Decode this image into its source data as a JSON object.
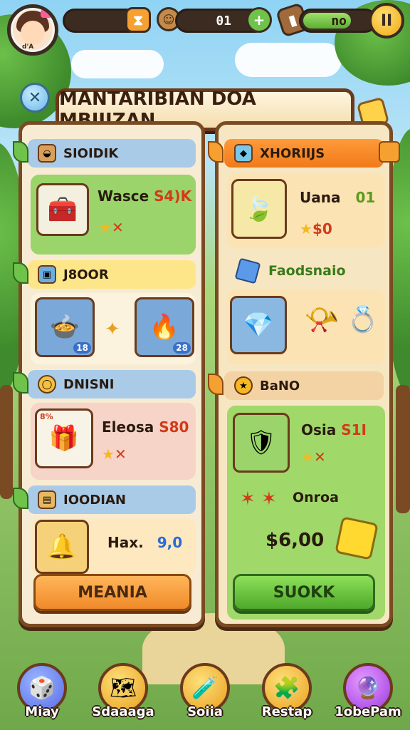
{
  "top_bar": {
    "avatar_tag": "d'A",
    "resource_bar_1": {
      "fill_fraction": 0.0
    },
    "resource_bar_2": {
      "value": "01",
      "fill_fraction": 0.85
    },
    "resource_bar_3": {
      "value": "no",
      "fill_fraction": 0.7
    },
    "plus_label": "+",
    "pause_label": "II"
  },
  "close_label": "✕",
  "title": "MANTARIBIAN DOA MBIIIZAN",
  "left_panel": {
    "sections": [
      {
        "label": "SIOIDIK",
        "icon": "bread-icon"
      },
      {
        "label": "J8OOR",
        "icon": "box-icon"
      },
      {
        "label": "DNISNI",
        "icon": "ring-icon"
      },
      {
        "label": "IOODIAN",
        "icon": "scroll-icon"
      }
    ],
    "item1": {
      "name": "Wasce",
      "price": "S4)K",
      "stars": "★",
      "mark": "✕"
    },
    "item2_a": {
      "badge": "18"
    },
    "item2_b": {
      "badge": "28"
    },
    "item3": {
      "name": "Eleosa",
      "price": "S80",
      "corner": "8%",
      "stars": "★",
      "mark": "✕"
    },
    "item4": {
      "name": "Hax.",
      "value": "9,0"
    },
    "button": "MEANIA"
  },
  "right_panel": {
    "sections": [
      {
        "label": "XHORIIJS",
        "icon": "diamond-icon"
      },
      {
        "label": "Faodsnaio",
        "icon": "cube-icon"
      },
      {
        "label": "BaNO",
        "icon": "star-icon"
      }
    ],
    "item1": {
      "name": "Uana",
      "value": "01",
      "stars": "★",
      "price": "$0"
    },
    "item3": {
      "name": "Osia",
      "price": "S1I",
      "stars": "★",
      "mark": "✕"
    },
    "stars_line": {
      "label": "Onroa"
    },
    "total": "$6,00",
    "button": "SUOKK"
  },
  "bottom_nav": [
    {
      "label": "Miay",
      "icon": "gem-chest-icon"
    },
    {
      "label": "Sdaaaga",
      "icon": "map-icon"
    },
    {
      "label": "Soiia",
      "icon": "potion-icon"
    },
    {
      "label": "Restap",
      "icon": "puzzle-icon"
    },
    {
      "label": "1obePam",
      "icon": "purple-gem-icon"
    }
  ],
  "colors": {
    "panel_border": "#7a4a22",
    "accent_orange": "#f08a2a",
    "accent_green": "#4ea82a",
    "price_red": "#d23a1a"
  }
}
